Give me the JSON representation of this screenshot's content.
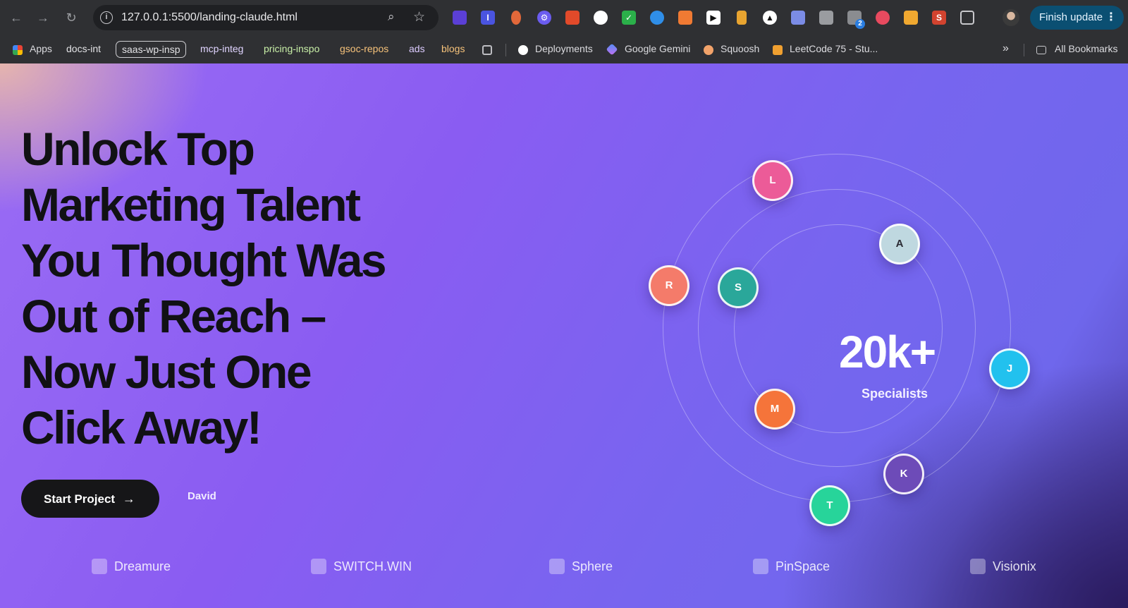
{
  "browser": {
    "url": "127.0.0.1:5500/landing-claude.html",
    "finish_update_label": "Finish update",
    "bookmarks": [
      {
        "label": "Apps"
      },
      {
        "label": "docs-int"
      },
      {
        "label": "saas-wp-insp"
      },
      {
        "label": "mcp-integ"
      },
      {
        "label": "pricing-inspo"
      },
      {
        "label": "gsoc-repos"
      },
      {
        "label": "ads"
      },
      {
        "label": "blogs"
      },
      {
        "label": "Deployments"
      },
      {
        "label": "Google Gemini"
      },
      {
        "label": "Squoosh"
      },
      {
        "label": "LeetCode 75 - Stu..."
      }
    ],
    "all_bookmarks_label": "All Bookmarks",
    "extension_badge": "2"
  },
  "hero": {
    "headline_lines": [
      "Unlock Top",
      "Marketing Talent",
      "You Thought Was",
      "Out of Reach –",
      "Now Just One",
      "Click Away!"
    ],
    "cta_label": "Start Project",
    "cta_arrow": "→",
    "secondary_label": "David"
  },
  "orbit": {
    "stat_value": "20k+",
    "stat_label": "Specialists",
    "nodes": [
      {
        "letter": "L",
        "color": "#ec5b98"
      },
      {
        "letter": "A",
        "color": "#bfd8e0"
      },
      {
        "letter": "R",
        "color": "#f47b6a"
      },
      {
        "letter": "S",
        "color": "#2aa79a"
      },
      {
        "letter": "J",
        "color": "#22c1ee"
      },
      {
        "letter": "M",
        "color": "#f5743a"
      },
      {
        "letter": "K",
        "color": "#6d4bb8"
      },
      {
        "letter": "T",
        "color": "#27d49a"
      }
    ]
  },
  "logos": [
    "Dreamure",
    "SWITCH.WIN",
    "Sphere",
    "PinSpace",
    "Visionix"
  ]
}
